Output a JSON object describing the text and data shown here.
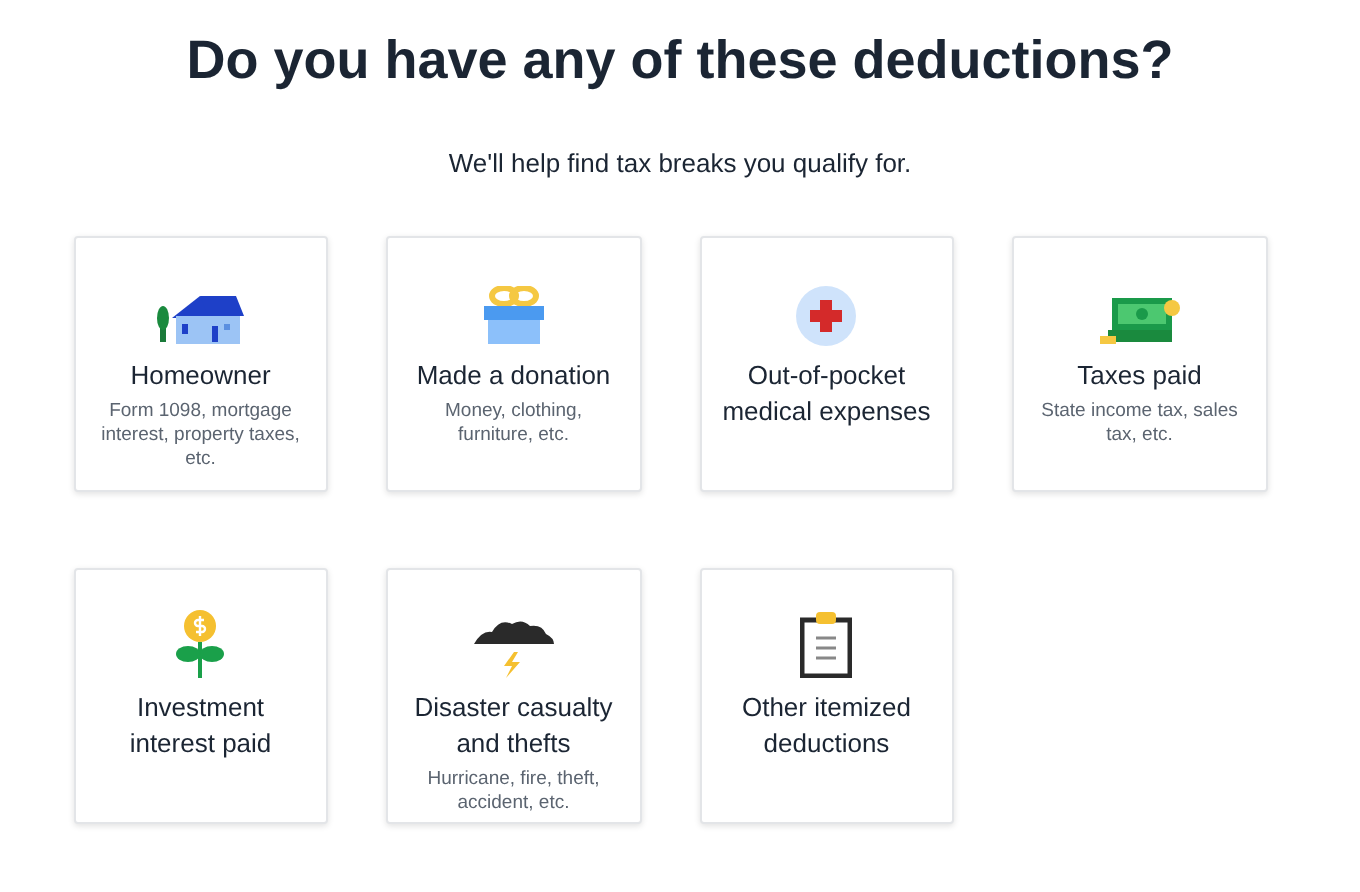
{
  "heading": "Do you have any of these deductions?",
  "subheading": "We'll help find tax breaks you qualify for.",
  "cards": [
    {
      "kind": "house",
      "title": "Homeowner",
      "detail": "Form 1098, mortgage interest, property taxes, etc."
    },
    {
      "kind": "gift",
      "title": "Made a donation",
      "detail": "Money, clothing, furniture, etc."
    },
    {
      "kind": "medical",
      "title": "Out-of-pocket medical expenses"
    },
    {
      "kind": "cash",
      "title": "Taxes paid",
      "detail": "State income tax, sales tax, etc."
    },
    {
      "kind": "plant",
      "title": "Investment interest paid"
    },
    {
      "kind": "storm",
      "title": "Disaster casualty and thefts",
      "detail": "Hurricane, fire, theft, accident, etc."
    },
    {
      "kind": "clipboard",
      "title": "Other itemized deductions"
    }
  ]
}
